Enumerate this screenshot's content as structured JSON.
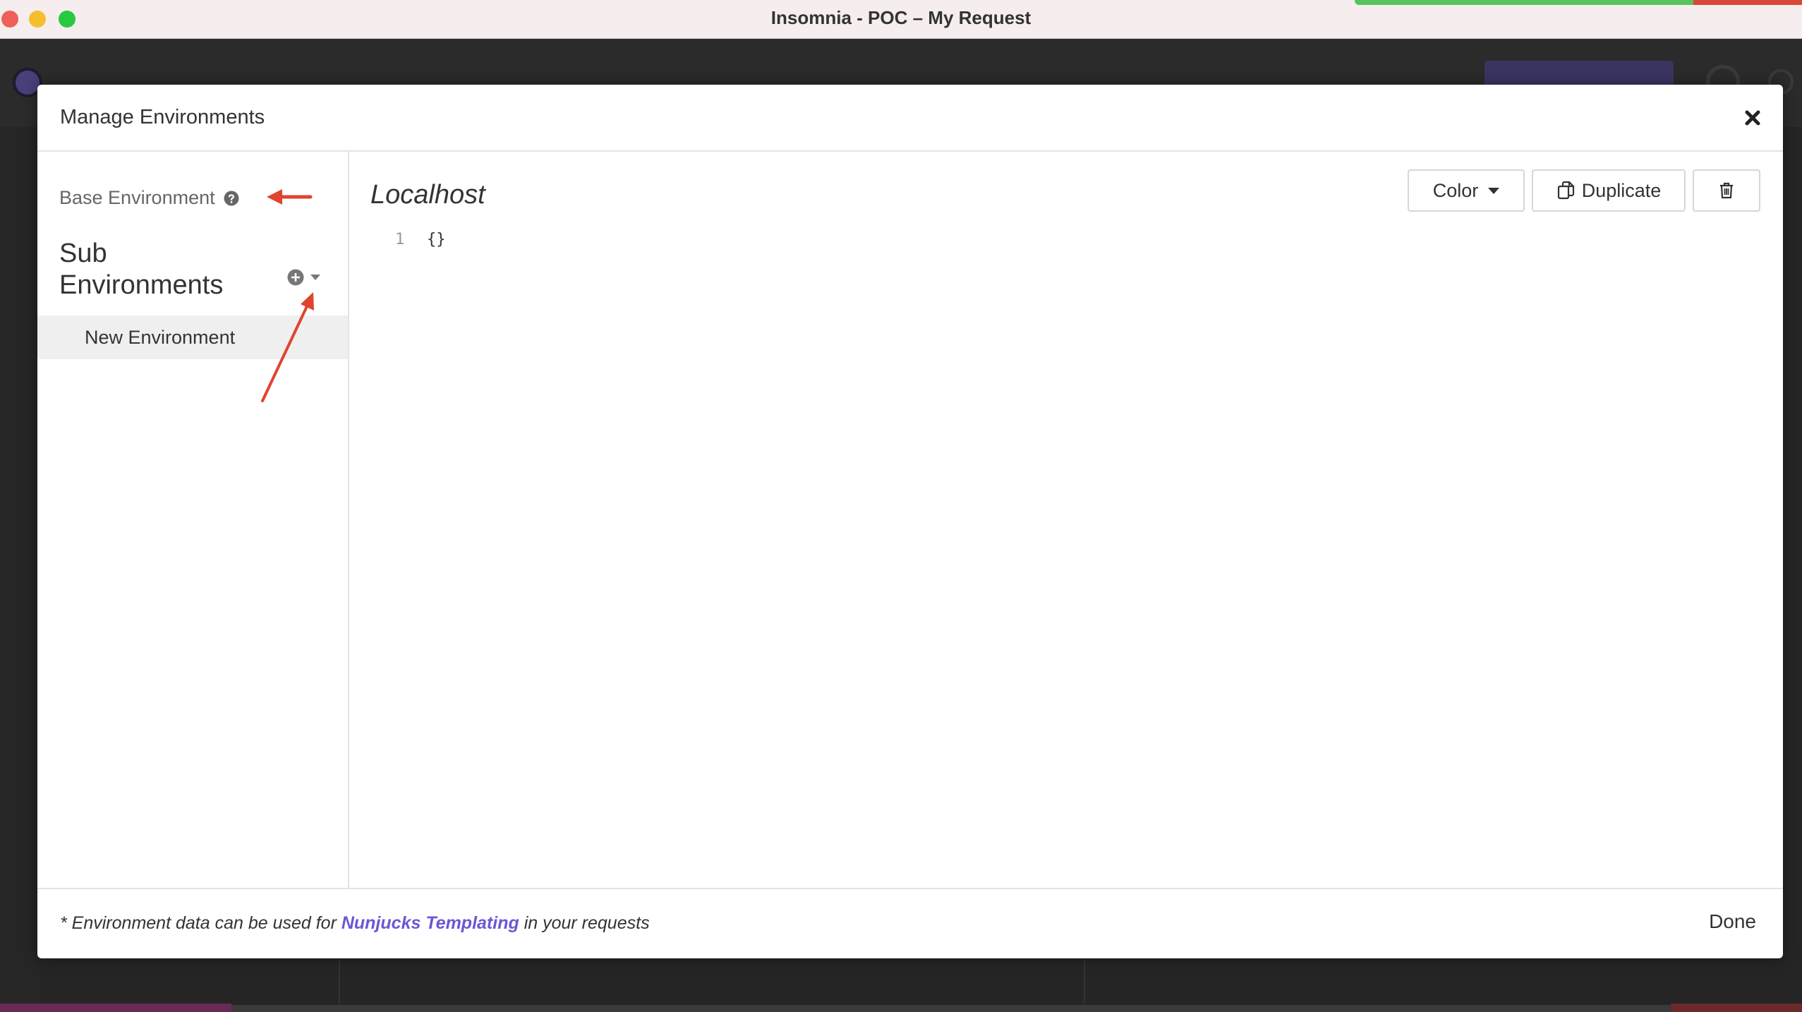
{
  "window": {
    "title": "Insomnia - POC – My Request"
  },
  "modal": {
    "title": "Manage Environments",
    "sidebar": {
      "base_environment_label": "Base Environment",
      "sub_environments_heading_line1": "Sub",
      "sub_environments_heading_line2": "Environments",
      "items": [
        {
          "label": "New Environment"
        }
      ]
    },
    "main": {
      "environment_name": "Localhost",
      "toolbar": {
        "color_label": "Color",
        "duplicate_label": "Duplicate"
      },
      "editor": {
        "lines": [
          {
            "number": "1",
            "code": "{}"
          }
        ]
      }
    },
    "footer": {
      "note_prefix": "* Environment data can be used for ",
      "note_link": "Nunjucks Templating",
      "note_suffix": " in your requests",
      "done_label": "Done"
    }
  },
  "colors": {
    "accent_link": "#6a57d5",
    "annotation_arrow": "#e0442f"
  }
}
